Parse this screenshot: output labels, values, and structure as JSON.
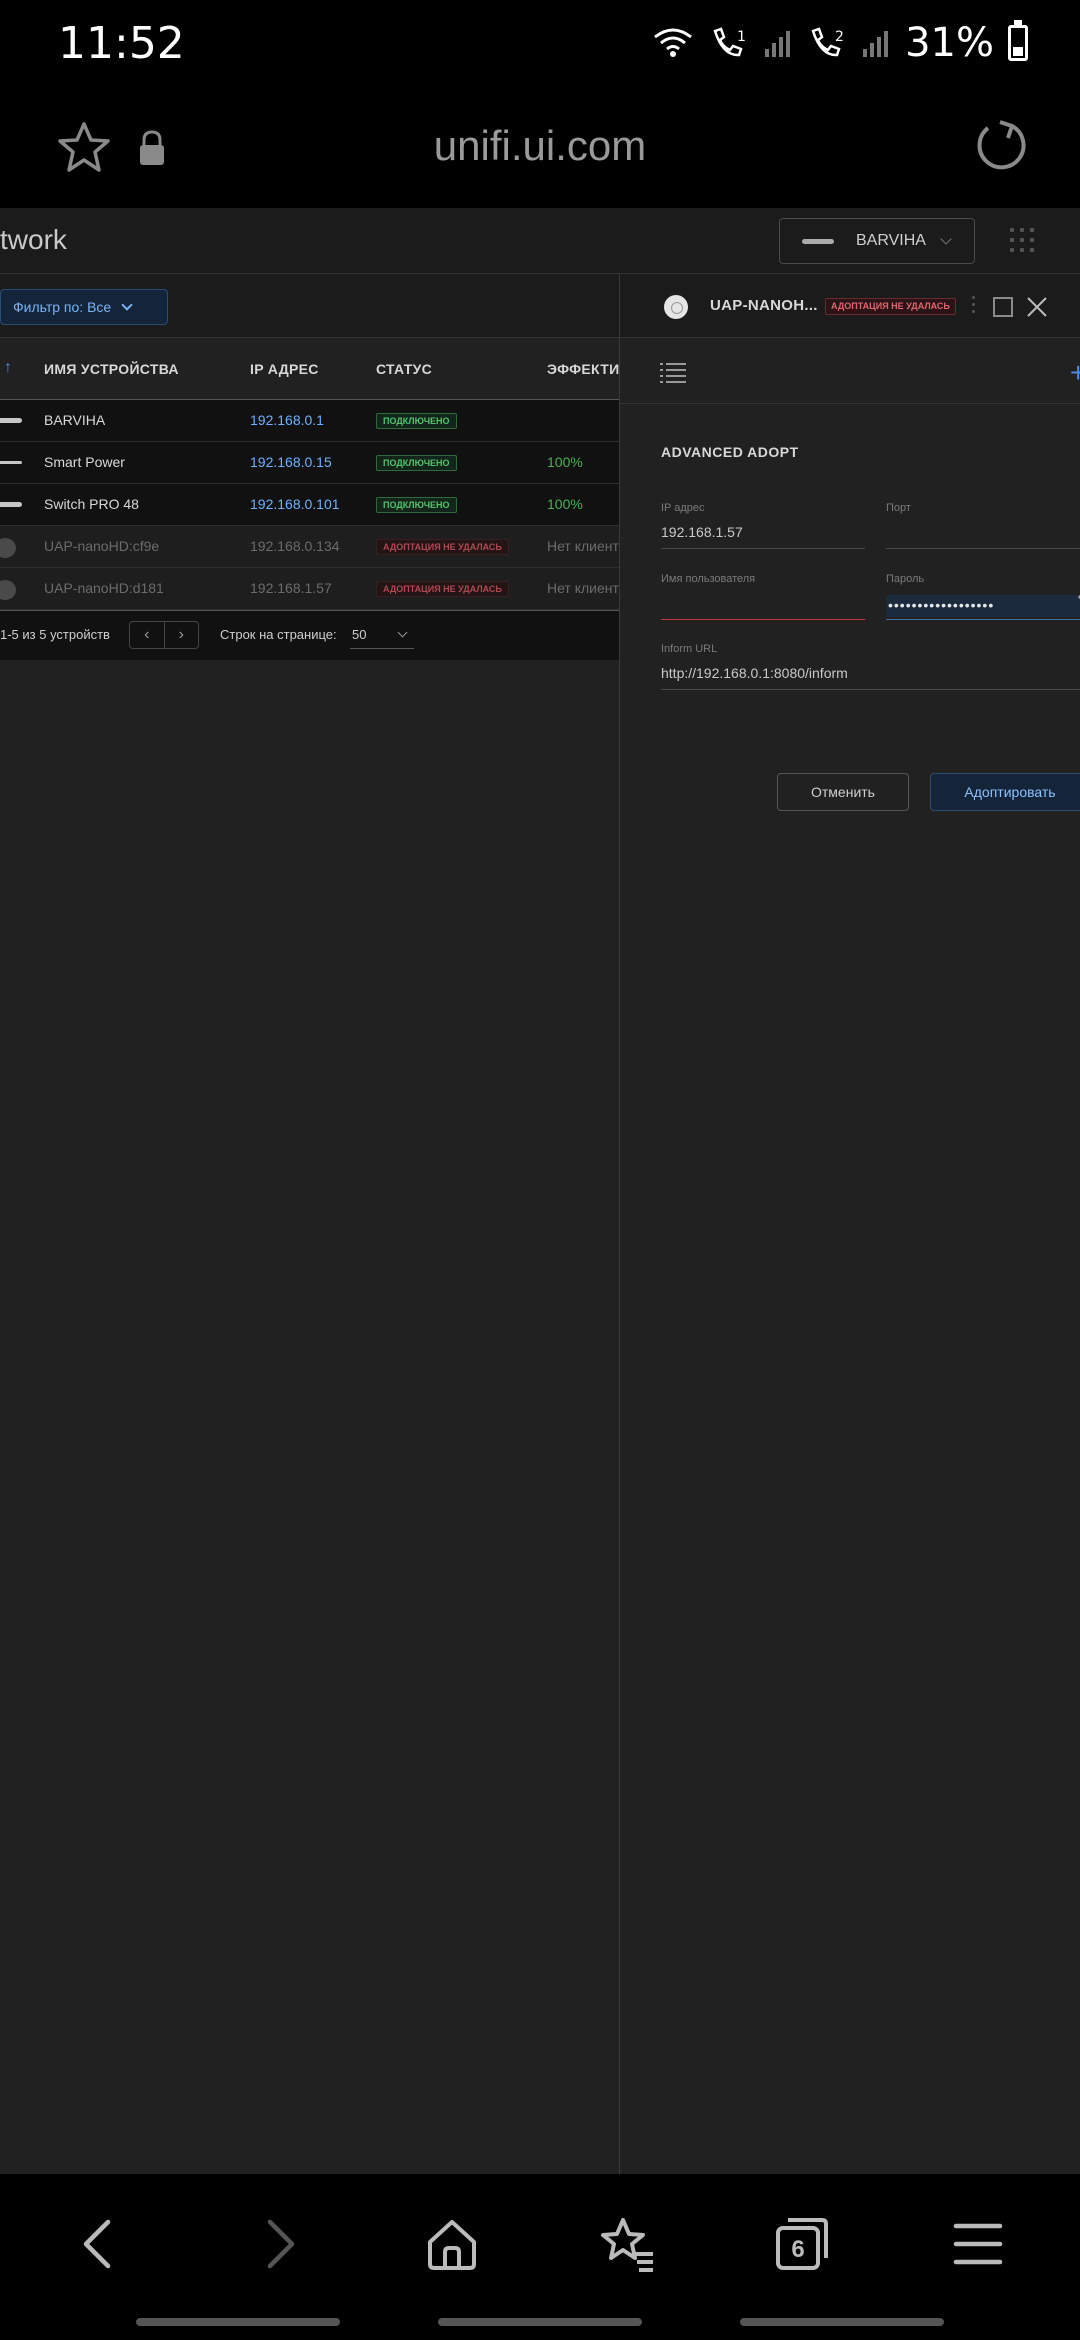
{
  "status_bar": {
    "time": "11:52",
    "battery": "31%"
  },
  "browser": {
    "url": "unifi.ui.com",
    "tab_count": "6"
  },
  "topnav": {
    "title": "twork",
    "site_name": "BARVIHA"
  },
  "filter": {
    "label": "Фильтр по: Все"
  },
  "table": {
    "headers": {
      "name": "ИМЯ УСТРОЙСТВА",
      "ip": "IP АДРЕС",
      "status": "СТАТУС",
      "exp": "ЭФФЕКТИ"
    },
    "rows": [
      {
        "name": "BARVIHA",
        "ip": "192.168.0.1",
        "status": "ПОДКЛЮЧЕНО",
        "exp": ""
      },
      {
        "name": "Smart Power",
        "ip": "192.168.0.15",
        "status": "ПОДКЛЮЧЕНО",
        "exp": "100%"
      },
      {
        "name": "Switch PRO 48",
        "ip": "192.168.0.101",
        "status": "ПОДКЛЮЧЕНО",
        "exp": "100%"
      },
      {
        "name": "UAP-nanoHD:cf9e",
        "ip": "192.168.0.134",
        "status": "АДОПТАЦИЯ НЕ УДАЛАСЬ",
        "exp": "Нет клиент"
      },
      {
        "name": "UAP-nanoHD:d181",
        "ip": "192.168.1.57",
        "status": "АДОПТАЦИЯ НЕ УДАЛАСЬ",
        "exp": "Нет клиент"
      }
    ],
    "footer": {
      "count": "1-5 из 5 устройств",
      "rows_label": "Строк на странице:",
      "rows_value": "50"
    }
  },
  "panel": {
    "device_name": "UAP-NANOH...",
    "device_status": "АДОПТАЦИЯ НЕ УДАЛАСЬ",
    "section_title": "ADVANCED ADOPT",
    "fields": {
      "ip_label": "IP адрес",
      "ip_value": "192.168.1.57",
      "port_label": "Порт",
      "port_value": "",
      "user_label": "Имя пользователя",
      "user_value": "",
      "pass_label": "Пароль",
      "pass_value": "••••••••••••••••••",
      "url_label": "Inform URL",
      "url_value": "http://192.168.0.1:8080/inform"
    },
    "cancel_label": "Отменить",
    "adopt_label": "Адоптировать"
  }
}
